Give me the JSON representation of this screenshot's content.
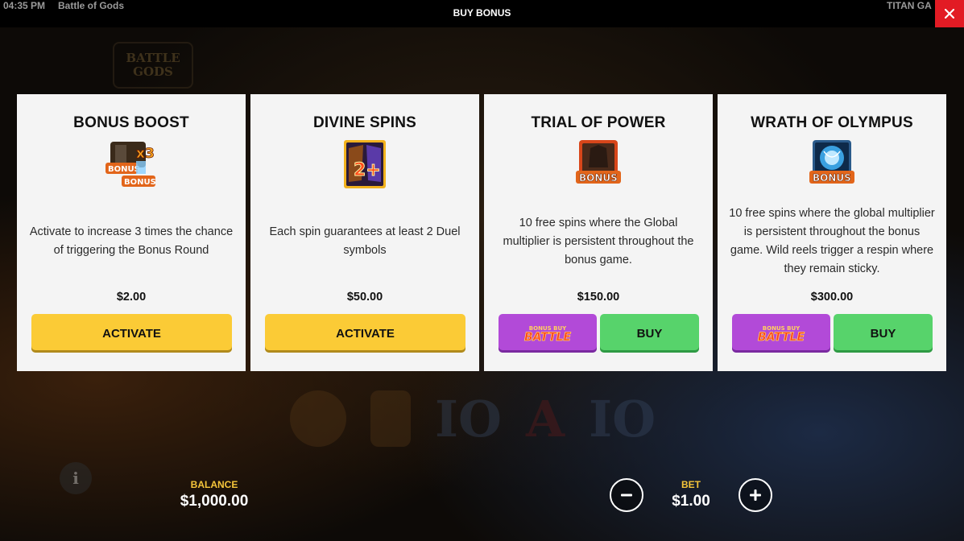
{
  "topbar": {
    "time": "04:35 PM",
    "game_title": "Battle of Gods",
    "dialog_title": "BUY BONUS",
    "provider": "TITAN GA",
    "close_icon": "close-icon"
  },
  "cards": [
    {
      "title": "BONUS BOOST",
      "icon": "bonus-x3-icon",
      "description": "Activate to increase 3 times the chance of triggering the Bonus Round",
      "price": "$2.00",
      "primary_label": "ACTIVATE"
    },
    {
      "title": "DIVINE SPINS",
      "icon": "duel-2plus-icon",
      "description": "Each spin guarantees at least 2 Duel symbols",
      "price": "$50.00",
      "primary_label": "ACTIVATE"
    },
    {
      "title": "TRIAL OF POWER",
      "icon": "bonus-warrior-icon",
      "description": "10 free spins where the Global multiplier is persistent throughout the bonus game.",
      "price": "$150.00",
      "battle_label": "BONUS BUY BATTLE",
      "buy_label": "BUY"
    },
    {
      "title": "WRATH OF OLYMPUS",
      "icon": "bonus-orb-icon",
      "description": "10 free spins where the global multiplier is persistent throughout the bonus game. Wild reels trigger a respin where they remain sticky.",
      "price": "$300.00",
      "battle_label": "BONUS BUY BATTLE",
      "buy_label": "BUY"
    }
  ],
  "footer": {
    "balance_label": "BALANCE",
    "balance_value": "$1,000.00",
    "bet_label": "BET",
    "bet_value": "$1.00",
    "minus_icon": "minus-icon",
    "plus_icon": "plus-icon",
    "info_icon": "info-icon"
  },
  "colors": {
    "activate": "#fbcb36",
    "buy": "#57d36b",
    "battle": "#b24ad8",
    "close": "#e21b24",
    "label_gold": "#f5c53a"
  }
}
